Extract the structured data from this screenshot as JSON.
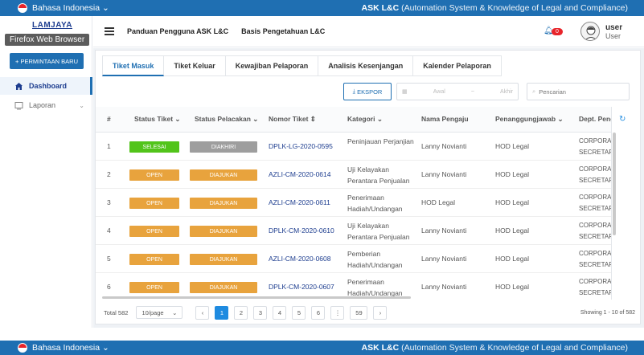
{
  "topbar": {
    "language": "Bahasa Indonesia",
    "app_name": "ASK L&C",
    "app_full": "(Automation System & Knowledge of Legal and Compliance)"
  },
  "sidebar": {
    "logo_text": "LAMJAYA",
    "browser_tooltip": "Firefox Web Browser",
    "new_request": "+ PERMINTAAN BARU",
    "items": [
      {
        "label": "Dashboard",
        "icon": "home-icon"
      },
      {
        "label": "Laporan",
        "icon": "report-icon"
      }
    ]
  },
  "header": {
    "links": [
      "Panduan Pengguna ASK L&C",
      "Basis Pengetahuan L&C"
    ],
    "notif_count": "0",
    "user_name": "user",
    "user_role": "User"
  },
  "tabs": [
    "Tiket Masuk",
    "Tiket Keluar",
    "Kewajiban Pelaporan",
    "Analisis Kesenjangan",
    "Kalender Pelaporan"
  ],
  "toolbar": {
    "export_label": "EKSPOR",
    "date_start_placeholder": "Awal",
    "date_sep": "~",
    "date_end_placeholder": "Akhir",
    "search_placeholder": "Pencarian"
  },
  "table": {
    "headers": [
      "#",
      "Status Tiket",
      "Status Pelacakan",
      "Nomor Tiket",
      "Kategori",
      "Nama Pengaju",
      "Penanggungjawab",
      "Dept. Peng"
    ],
    "rows": [
      {
        "no": "1",
        "status": "SELESAI",
        "tracking": "DIAKHIRI",
        "ticket": "DPLK-LG-2020-0595",
        "category": "Peninjauan Perjanjian",
        "requester": "Lanny Novianti",
        "pic": "HOD Legal",
        "dept": "CORPORATE SECRETARY"
      },
      {
        "no": "2",
        "status": "OPEN",
        "tracking": "DIAJUKAN",
        "ticket": "AZLI-CM-2020-0614",
        "category": "Uji Kelayakan Perantara Penjualan",
        "requester": "Lanny Novianti",
        "pic": "HOD Legal",
        "dept": "CORPORATE SECRETARY"
      },
      {
        "no": "3",
        "status": "OPEN",
        "tracking": "DIAJUKAN",
        "ticket": "AZLI-CM-2020-0611",
        "category": "Penerimaan Hadiah/Undangan",
        "requester": "HOD Legal",
        "pic": "HOD Legal",
        "dept": "CORPORATE SECRETARY"
      },
      {
        "no": "4",
        "status": "OPEN",
        "tracking": "DIAJUKAN",
        "ticket": "DPLK-CM-2020-0610",
        "category": "Uji Kelayakan Perantara Penjualan",
        "requester": "Lanny Novianti",
        "pic": "HOD Legal",
        "dept": "CORPORATE SECRETARY"
      },
      {
        "no": "5",
        "status": "OPEN",
        "tracking": "DIAJUKAN",
        "ticket": "AZLI-CM-2020-0608",
        "category": "Pemberian Hadiah/Undangan",
        "requester": "Lanny Novianti",
        "pic": "HOD Legal",
        "dept": "CORPORATE SECRETARY"
      },
      {
        "no": "6",
        "status": "OPEN",
        "tracking": "DIAJUKAN",
        "ticket": "DPLK-CM-2020-0607",
        "category": "Penerimaan Hadiah/Undangan",
        "requester": "Lanny Novianti",
        "pic": "HOD Legal",
        "dept": "CORPORATE SECRETARY"
      }
    ]
  },
  "footer": {
    "total": "Total 582",
    "page_size": "10/page",
    "pages": [
      "1",
      "2",
      "3",
      "4",
      "5",
      "6",
      "⋮",
      "59"
    ],
    "showing": "Showing 1 - 10 of 582"
  },
  "colors": {
    "primary": "#1f6fb2",
    "done": "#52c41a",
    "open": "#e8a33d",
    "ended": "#9e9e9e",
    "badge": "#e8242a"
  }
}
